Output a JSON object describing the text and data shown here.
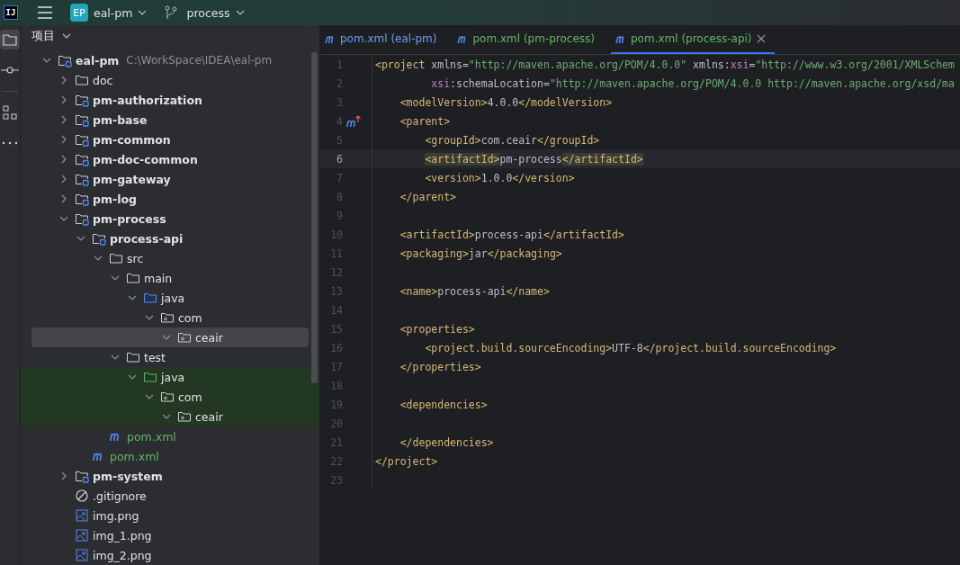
{
  "title_bar": {
    "logo": "IJ",
    "project_badge": "EP",
    "project": "eal-pm",
    "branch": "process"
  },
  "tool_strip": [
    {
      "kind": "project",
      "selected": true
    },
    {
      "kind": "commit",
      "selected": false
    },
    {
      "kind": "structure",
      "selected": false
    },
    {
      "kind": "more",
      "selected": false
    }
  ],
  "project_panel": {
    "title": "项目",
    "tree": [
      {
        "name": "eal-pm",
        "path": "C:\\WorkSpace\\IDEA\\eal-pm",
        "kind": "module",
        "expanded": true,
        "selected": false,
        "children": [
          {
            "name": "doc",
            "kind": "folder",
            "expanded": false,
            "selected": false
          },
          {
            "name": "pm-authorization",
            "kind": "module",
            "expanded": false,
            "selected": false
          },
          {
            "name": "pm-base",
            "kind": "module",
            "expanded": false,
            "selected": false
          },
          {
            "name": "pm-common",
            "kind": "module",
            "expanded": false,
            "selected": false
          },
          {
            "name": "pm-doc-common",
            "kind": "module",
            "expanded": false,
            "selected": false
          },
          {
            "name": "pm-gateway",
            "kind": "module",
            "expanded": false,
            "selected": false
          },
          {
            "name": "pm-log",
            "kind": "module",
            "expanded": false,
            "selected": false
          },
          {
            "name": "pm-process",
            "kind": "module",
            "expanded": true,
            "selected": false,
            "children": [
              {
                "name": "process-api",
                "kind": "module",
                "expanded": true,
                "selected": false,
                "children": [
                  {
                    "name": "src",
                    "kind": "folder",
                    "expanded": true,
                    "selected": false,
                    "children": [
                      {
                        "name": "main",
                        "kind": "folder",
                        "expanded": true,
                        "selected": false,
                        "children": [
                          {
                            "name": "java",
                            "kind": "source-folder",
                            "expanded": true,
                            "selected": false,
                            "children": [
                              {
                                "name": "com",
                                "kind": "package",
                                "expanded": true,
                                "selected": false,
                                "children": [
                                  {
                                    "name": "ceair",
                                    "kind": "package",
                                    "expanded": true,
                                    "selected": true
                                  }
                                ]
                              }
                            ]
                          }
                        ]
                      },
                      {
                        "name": "test",
                        "kind": "folder",
                        "expanded": true,
                        "selected": false,
                        "children": [
                          {
                            "name": "java",
                            "kind": "test-folder",
                            "expanded": true,
                            "selected": false,
                            "children": [
                              {
                                "name": "com",
                                "kind": "package",
                                "expanded": true,
                                "selected": false,
                                "children": [
                                  {
                                    "name": "ceair",
                                    "kind": "package",
                                    "expanded": true,
                                    "selected": false
                                  }
                                ]
                              }
                            ]
                          }
                        ]
                      }
                    ]
                  },
                  {
                    "name": "pom.xml",
                    "kind": "maven",
                    "color": "#5fb865",
                    "selected": false
                  }
                ]
              },
              {
                "name": "pom.xml",
                "kind": "maven",
                "color": "#5fb865",
                "selected": false
              }
            ]
          },
          {
            "name": "pm-system",
            "kind": "module",
            "expanded": false,
            "selected": false
          },
          {
            "name": ".gitignore",
            "kind": "ignore",
            "selected": false
          },
          {
            "name": "img.png",
            "kind": "image",
            "selected": false
          },
          {
            "name": "img_1.png",
            "kind": "image",
            "selected": false
          },
          {
            "name": "img_2.png",
            "kind": "image",
            "selected": false
          }
        ]
      }
    ]
  },
  "editor": {
    "tabs": [
      {
        "label": "pom.xml (eal-pm)",
        "color": "#6f9cf2",
        "selected": false
      },
      {
        "label": "pom.xml (pm-process)",
        "color": "#5fb865",
        "selected": false
      },
      {
        "label": "pom.xml (process-api)",
        "color": "#5fb865",
        "selected": true
      }
    ],
    "lines": [
      {
        "number": "1",
        "kind": "code",
        "selected": false,
        "tokens": [
          {
            "kind": "tag",
            "text": "<project"
          },
          {
            "kind": "attr",
            "text": " xmlns="
          },
          {
            "kind": "value",
            "text": "\"http://maven.apache.org/POM/4.0.0\""
          },
          {
            "kind": "attr",
            "text": " xmlns:"
          },
          {
            "kind": "ns",
            "text": "xsi"
          },
          {
            "kind": "attr",
            "text": "="
          },
          {
            "kind": "value",
            "text": "\"http://www.w3.org/2001/XMLSchem"
          }
        ]
      },
      {
        "number": "2",
        "kind": "code",
        "selected": false,
        "tokens": [
          {
            "kind": "ns",
            "text": "         xsi"
          },
          {
            "kind": "attr",
            "text": ":schemaLocation="
          },
          {
            "kind": "value",
            "text": "\"http://maven.apache.org/POM/4.0.0 http://maven.apache.org/xsd/ma"
          }
        ]
      },
      {
        "number": "3",
        "kind": "code",
        "selected": false,
        "tokens": [
          {
            "kind": "tag",
            "text": "    <modelVersion>"
          },
          {
            "kind": "text",
            "text": "4.0.0"
          },
          {
            "kind": "tag",
            "text": "</modelVersion>"
          }
        ]
      },
      {
        "number": "4",
        "kind": "parent-ref",
        "selected": false,
        "tokens": [
          {
            "kind": "tag",
            "text": "    <parent>"
          }
        ]
      },
      {
        "number": "5",
        "kind": "code",
        "selected": false,
        "tokens": [
          {
            "kind": "tag",
            "text": "        <groupId>"
          },
          {
            "kind": "text",
            "text": "com.ceair"
          },
          {
            "kind": "tag",
            "text": "</groupId>"
          }
        ]
      },
      {
        "number": "6",
        "kind": "code",
        "selected": true,
        "tokens": [
          {
            "kind": "tag",
            "text": "        <artifactId>",
            "matched": true
          },
          {
            "kind": "text",
            "text": "pm-process"
          },
          {
            "kind": "tag",
            "text": "</artifactId>",
            "matched": true
          }
        ]
      },
      {
        "number": "7",
        "kind": "code",
        "selected": false,
        "tokens": [
          {
            "kind": "tag",
            "text": "        <version>"
          },
          {
            "kind": "text",
            "text": "1.0.0"
          },
          {
            "kind": "tag",
            "text": "</version>"
          }
        ]
      },
      {
        "number": "8",
        "kind": "code",
        "selected": false,
        "tokens": [
          {
            "kind": "tag",
            "text": "    </parent>"
          }
        ]
      },
      {
        "number": "9",
        "kind": "code",
        "selected": false
      },
      {
        "number": "10",
        "kind": "code",
        "selected": false,
        "tokens": [
          {
            "kind": "tag",
            "text": "    <artifactId>"
          },
          {
            "kind": "text",
            "text": "process-api"
          },
          {
            "kind": "tag",
            "text": "</artifactId>"
          }
        ]
      },
      {
        "number": "11",
        "kind": "code",
        "selected": false,
        "tokens": [
          {
            "kind": "tag",
            "text": "    <packaging>"
          },
          {
            "kind": "text",
            "text": "jar"
          },
          {
            "kind": "tag",
            "text": "</packaging>"
          }
        ]
      },
      {
        "number": "12",
        "kind": "code",
        "selected": false
      },
      {
        "number": "13",
        "kind": "code",
        "selected": false,
        "tokens": [
          {
            "kind": "tag",
            "text": "    <name>"
          },
          {
            "kind": "text",
            "text": "process-api"
          },
          {
            "kind": "tag",
            "text": "</name>"
          }
        ]
      },
      {
        "number": "14",
        "kind": "code",
        "selected": false
      },
      {
        "number": "15",
        "kind": "code",
        "selected": false,
        "tokens": [
          {
            "kind": "tag",
            "text": "    <properties>"
          }
        ]
      },
      {
        "number": "16",
        "kind": "code",
        "selected": false,
        "tokens": [
          {
            "kind": "tag",
            "text": "        <project.build.sourceEncoding>"
          },
          {
            "kind": "text",
            "text": "UTF-8"
          },
          {
            "kind": "tag",
            "text": "</project.build.sourceEncoding>"
          }
        ]
      },
      {
        "number": "17",
        "kind": "code",
        "selected": false,
        "tokens": [
          {
            "kind": "tag",
            "text": "    </properties>"
          }
        ]
      },
      {
        "number": "18",
        "kind": "code",
        "selected": false
      },
      {
        "number": "19",
        "kind": "code",
        "selected": false,
        "tokens": [
          {
            "kind": "tag",
            "text": "    <dependencies>"
          }
        ]
      },
      {
        "number": "20",
        "kind": "code",
        "selected": false
      },
      {
        "number": "21",
        "kind": "code",
        "selected": false,
        "tokens": [
          {
            "kind": "tag",
            "text": "    </dependencies>"
          }
        ]
      },
      {
        "number": "22",
        "kind": "code",
        "selected": false,
        "tokens": [
          {
            "kind": "tag",
            "text": "</project>"
          }
        ]
      },
      {
        "number": "23",
        "kind": "code",
        "selected": false
      }
    ]
  }
}
